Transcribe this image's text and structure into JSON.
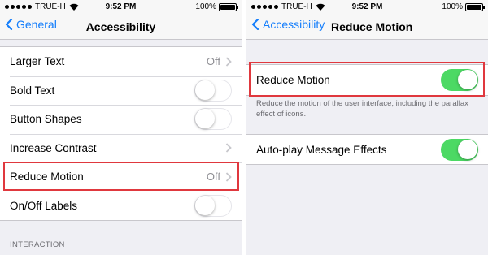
{
  "left": {
    "status": {
      "carrier": "TRUE-H",
      "time": "9:52 PM",
      "battery": "100%",
      "battery_level": 1.0
    },
    "nav": {
      "back_label": "General",
      "title": "Accessibility"
    },
    "rows": [
      {
        "label": "Larger Text",
        "value": "Off"
      },
      {
        "label": "Bold Text"
      },
      {
        "label": "Button Shapes"
      },
      {
        "label": "Increase Contrast"
      },
      {
        "label": "Reduce Motion",
        "value": "Off"
      },
      {
        "label": "On/Off Labels"
      }
    ],
    "toggles": {
      "bold_text": false,
      "button_shapes": false,
      "on_off_labels": false
    },
    "section_header": "INTERACTION"
  },
  "right": {
    "status": {
      "carrier": "TRUE-H",
      "time": "9:52 PM",
      "battery": "100%",
      "battery_level": 1.0
    },
    "nav": {
      "back_label": "Accessibility",
      "title": "Reduce Motion"
    },
    "reduce_motion": {
      "label": "Reduce Motion",
      "on": true
    },
    "footer_note": "Reduce the motion of the user interface, including the parallax effect of icons.",
    "autoplay": {
      "label": "Auto-play Message Effects",
      "on": true
    }
  },
  "colors": {
    "accent": "#157efb",
    "toggle_on": "#4cd964",
    "highlight": "#e0383e",
    "background": "#efeff4"
  },
  "icons": [
    "wifi-icon",
    "signal-icon",
    "battery-icon",
    "back-chevron-icon",
    "chevron-right-icon"
  ]
}
